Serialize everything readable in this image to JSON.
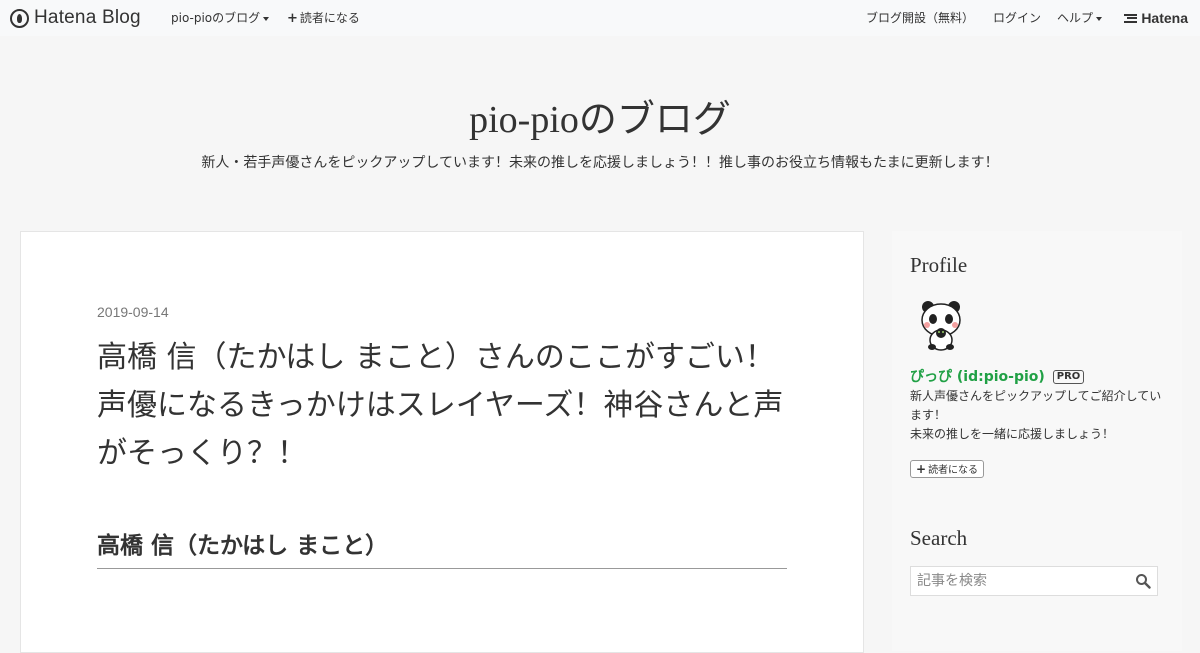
{
  "topbar": {
    "logo_text": "Hatena Blog",
    "blog_menu": "pio-pioのブログ",
    "subscribe": "読者になる",
    "open_blog": "ブログ開設（無料）",
    "login": "ログイン",
    "help": "ヘルプ",
    "brand": "Hatena"
  },
  "blog": {
    "title": "pio-pioのブログ",
    "description": "新人・若手声優さんをピックアップしています！未来の推しを応援しましょう！！推し事のお役立ち情報もたまに更新します！"
  },
  "entry": {
    "date": "2019-09-14",
    "title": "高橋 信（たかはし まこと）さんのここがすごい！声優になるきっかけはスレイヤーズ！神谷さんと声がそっくり？！",
    "heading": "高橋 信（たかはし まこと）"
  },
  "sidebar": {
    "profile_heading": "Profile",
    "profile_name": "ぴっぴ (id:pio-pio)",
    "pro_badge": "PRO",
    "profile_desc_1": "新人声優さんをピックアップしてご紹介しています！",
    "profile_desc_2": "未来の推しを一緒に応援しましょう！",
    "follow_label": "読者になる",
    "search_heading": "Search",
    "search_placeholder": "記事を検索"
  },
  "icons": {
    "logo": "hatena-blog-logo-icon",
    "plus": "plus-icon",
    "caret": "caret-down-icon",
    "search": "search-icon",
    "avatar": "panda-avatar-icon"
  },
  "colors": {
    "profile_name": "#20a045",
    "background": "#f6f6f6"
  }
}
